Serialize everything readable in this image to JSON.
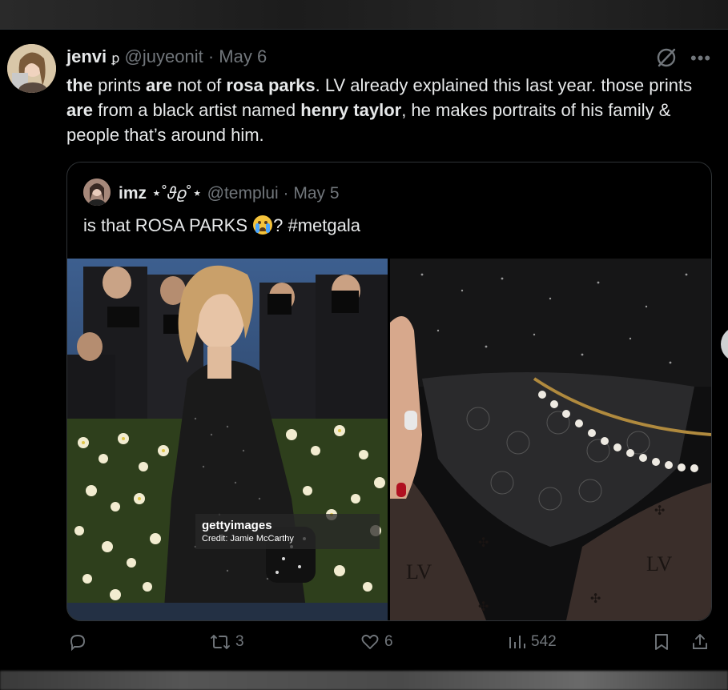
{
  "tweet": {
    "author_name": "jenvi",
    "author_handle": "@juyeonit",
    "date": "May 6",
    "separator": "·",
    "text_parts": [
      {
        "text": "the",
        "bold": true
      },
      {
        "text": " prints ",
        "bold": false
      },
      {
        "text": "are",
        "bold": true
      },
      {
        "text": " not of ",
        "bold": false
      },
      {
        "text": "rosa parks",
        "bold": true
      },
      {
        "text": ". LV already explained this last year. those prints ",
        "bold": false
      },
      {
        "text": "are",
        "bold": true
      },
      {
        "text": " from a black artist named ",
        "bold": false
      },
      {
        "text": "henry taylor",
        "bold": true
      },
      {
        "text": ", he makes portraits of his family & people that’s around him.",
        "bold": false
      }
    ]
  },
  "quote": {
    "author_name": "imz",
    "author_decoration": "⋆˚𝜗𝜚˚⋆",
    "author_handle": "@templui",
    "date": "May 5",
    "separator": "·",
    "text_before_emoji": "is that ROSA PARKS",
    "text_after_emoji": "? #metgala",
    "emoji_icon": "loudly-crying-face-icon",
    "image_watermark": {
      "brand": "gettyimages",
      "credit": "Credit: Jamie McCarthy"
    }
  },
  "actions": {
    "reply_count": "",
    "retweet_count": "3",
    "like_count": "6",
    "views_count": "542"
  },
  "colors": {
    "background": "#000000",
    "text": "#e7e9ea",
    "muted": "#71767b",
    "border": "#2f3336"
  }
}
